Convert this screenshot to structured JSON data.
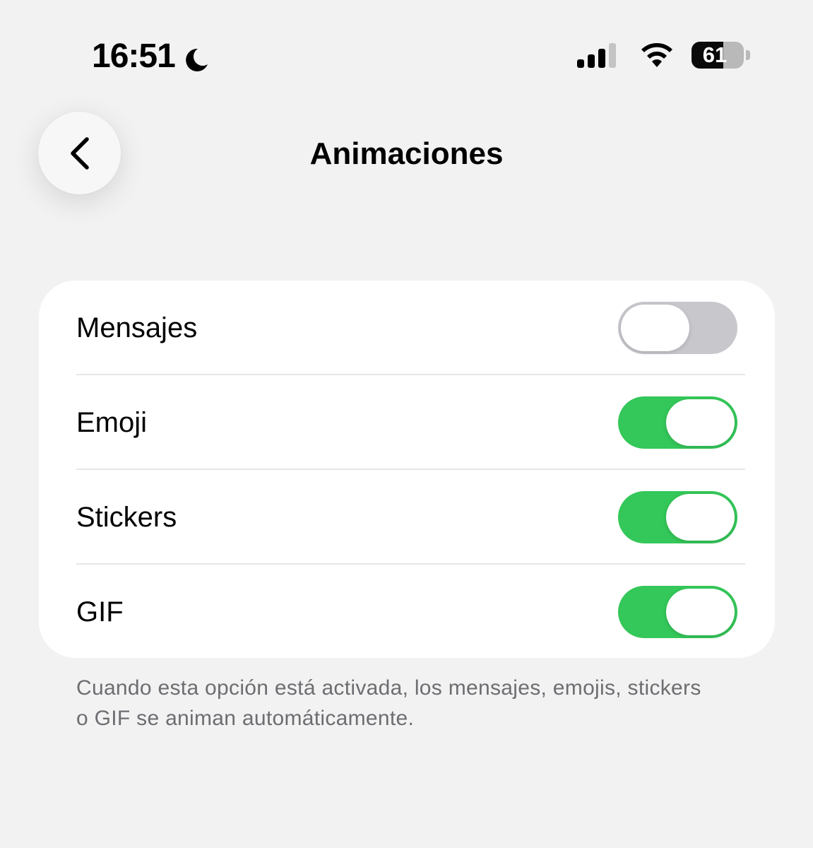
{
  "status_bar": {
    "time": "16:51",
    "focus_icon": "moon-icon",
    "signal_icon": "cellular-signal-icon",
    "signal_bars": 3,
    "signal_bars_total": 4,
    "wifi_icon": "wifi-icon",
    "battery_icon": "battery-icon",
    "battery_level": "61",
    "battery_fraction": 0.61
  },
  "nav": {
    "back_icon": "chevron-left-icon",
    "title": "Animaciones"
  },
  "settings": {
    "items": [
      {
        "label": "Mensajes",
        "enabled": false
      },
      {
        "label": "Emoji",
        "enabled": true
      },
      {
        "label": "Stickers",
        "enabled": true
      },
      {
        "label": "GIF",
        "enabled": true
      }
    ]
  },
  "footnote": "Cuando esta opción está activada, los mensajes, emojis, stickers o GIF se animan automáticamente.",
  "colors": {
    "background": "#f2f2f2",
    "card": "#ffffff",
    "toggle_on": "#34c759",
    "toggle_off": "#c7c7cc",
    "footnote_text": "#6d6d72"
  }
}
